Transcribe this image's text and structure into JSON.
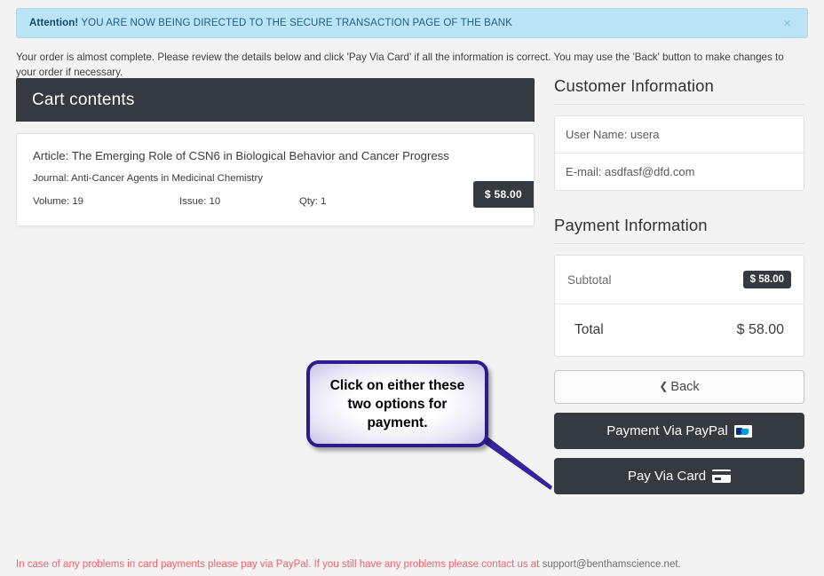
{
  "alert": {
    "strong": "Attention!",
    "message": " YOU ARE NOW BEING DIRECTED TO THE SECURE TRANSACTION PAGE OF THE BANK",
    "close_label": "×"
  },
  "intro": "Your order is almost complete. Please review the details below and click 'Pay Via Card' if all the information is correct. You may use the 'Back' button to make changes to your order if necessary.",
  "cart": {
    "header_title": "Cart contents",
    "item": {
      "article": "Article: The Emerging Role of CSN6 in Biological Behavior and Cancer Progress",
      "journal": "Journal: Anti-Cancer Agents in Medicinal Chemistry",
      "volume": "Volume: 19",
      "issue": "Issue: 10",
      "qty": "Qty: 1",
      "price": "$ 58.00"
    }
  },
  "customer": {
    "section_title": "Customer Information",
    "user_name": "User Name: usera",
    "email": "E-mail: asdfasf@dfd.com"
  },
  "payment": {
    "section_title": "Payment Information",
    "subtotal_label": "Subtotal",
    "subtotal_value": "$ 58.00",
    "total_label": "Total",
    "total_value": "$ 58.00"
  },
  "buttons": {
    "back": "Back",
    "paypal": "Payment Via PayPal",
    "card": "Pay Via Card"
  },
  "callout": {
    "text": "Click on either these two options for payment.",
    "border_color": "#2b1b8c"
  },
  "footer": {
    "text": "In case of any problems in card payments please pay via PayPal. If you still have any problems please contact us at ",
    "email": "support@benthamscience.net.",
    "color": "#f2616c"
  }
}
